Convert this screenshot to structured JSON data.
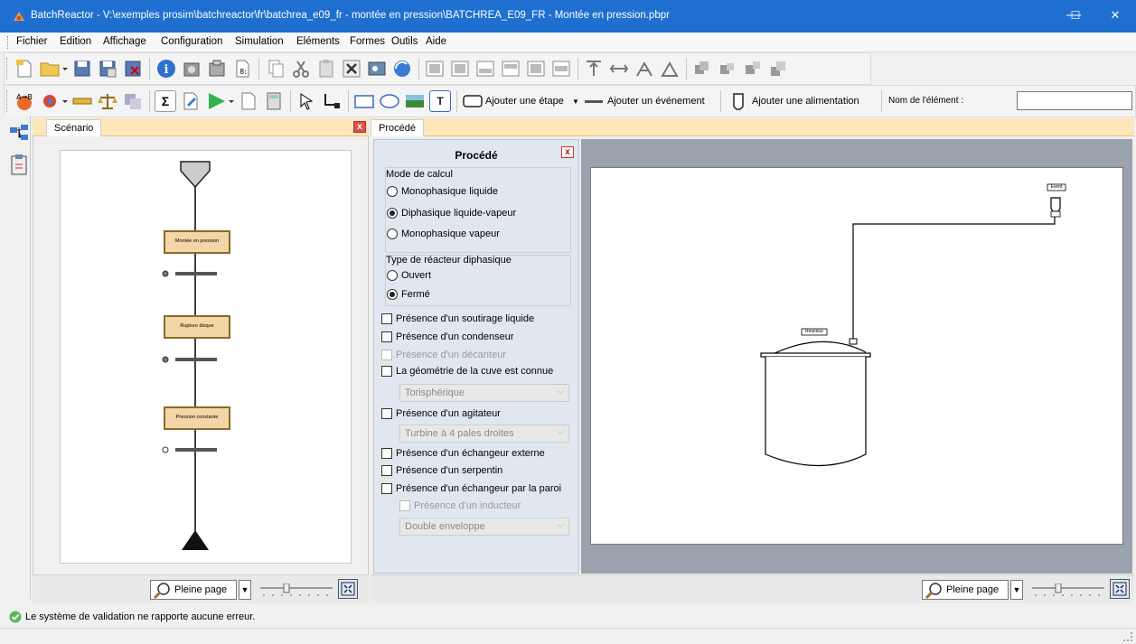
{
  "window": {
    "title": "BatchReactor - V:\\exemples prosim\\batchreactor\\fr\\batchrea_e09_fr - montée en pression\\BATCHREA_E09_FR - Montée en pression.pbpr",
    "minimize": "—",
    "maximize": "☐",
    "close": "✕"
  },
  "menu": [
    "Fichier",
    "Edition",
    "Affichage",
    "Configuration",
    "Simulation",
    "Eléments",
    "Formes",
    "Outils",
    "Aide"
  ],
  "toolbar2": {
    "add_step": "Ajouter une étape",
    "add_event": "Ajouter un événement",
    "add_feed": "Ajouter une alimentation",
    "element_name_label": "Nom de l'élément :",
    "element_name_value": "",
    "text_tool": "T",
    "sigma": "Σ"
  },
  "scenario": {
    "tab": "Scénario",
    "steps": [
      "Montée en pression",
      "Rupture disque",
      "Pression constante"
    ],
    "zoom_label": "Pleine page"
  },
  "process": {
    "tab": "Procédé",
    "panel_title": "Procédé",
    "calc_mode": {
      "title": "Mode de calcul",
      "options": [
        "Monophasique liquide",
        "Diphasique liquide-vapeur",
        "Monophasique vapeur"
      ],
      "selected": "Diphasique liquide-vapeur"
    },
    "reactor_type": {
      "title": "Type de réacteur diphasique",
      "options": [
        "Ouvert",
        "Fermé"
      ],
      "selected": "Fermé"
    },
    "checkboxes": {
      "soutirage": "Présence d'un soutirage liquide",
      "condenseur": "Présence d'un condenseur",
      "decanteur": "Présence d'un décanteur",
      "geometrie": "La géométrie de la cuve est connue",
      "agitateur": "Présence d'un agitateur",
      "echangeur_ext": "Présence d'un échangeur externe",
      "serpentin": "Présence d'un serpentin",
      "echangeur_paroi": "Présence d'un échangeur par la paroi",
      "inducteur": "Présence d'un inducteur"
    },
    "combos": {
      "geometrie": "Torisphérique",
      "agitateur": "Turbine à 4 pales droites",
      "paroi": "Double enveloppe"
    },
    "diagram": {
      "reactor_label": "Réacteur",
      "vent_label": "Évent"
    },
    "zoom_label": "Pleine page"
  },
  "status": {
    "message": "Le système de validation ne rapporte aucune erreur."
  },
  "colors": {
    "titlebar": "#1e6fd0",
    "tab_header": "#fde6b9",
    "step_box": "#f2d6a6",
    "step_border": "#8a6a2a",
    "status_ok": "#5cb85c"
  }
}
